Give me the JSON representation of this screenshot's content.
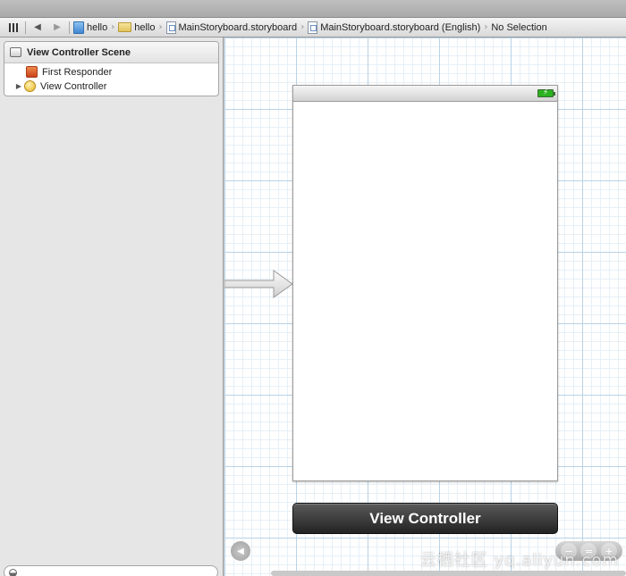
{
  "jumpbar": {
    "icons": {
      "grid": "related-items-grid-icon",
      "back": "back-arrow-icon",
      "forward": "forward-arrow-icon"
    },
    "back_glyph": "◀",
    "forward_glyph": "▶",
    "crumbs": [
      {
        "label": "hello",
        "icon": "project-icon"
      },
      {
        "label": "hello",
        "icon": "folder-icon"
      },
      {
        "label": "MainStoryboard.storyboard",
        "icon": "storyboard-file-icon"
      },
      {
        "label": "MainStoryboard.storyboard (English)",
        "icon": "storyboard-file-icon"
      },
      {
        "label": "No Selection"
      }
    ],
    "separator": "›"
  },
  "outline": {
    "scene_title": "View Controller Scene",
    "items": [
      {
        "label": "First Responder",
        "icon": "first-responder-icon",
        "expandable": false
      },
      {
        "label": "View Controller",
        "icon": "view-controller-icon",
        "expandable": true
      }
    ],
    "disclosure_glyph": "▶"
  },
  "canvas": {
    "view_controller_label": "View Controller",
    "battery_glyph": "⚡",
    "nav_back_glyph": "◀",
    "zoom_buttons": [
      "−",
      "=",
      "+"
    ]
  },
  "watermark": "云栖社区 yq.aliyun.com"
}
